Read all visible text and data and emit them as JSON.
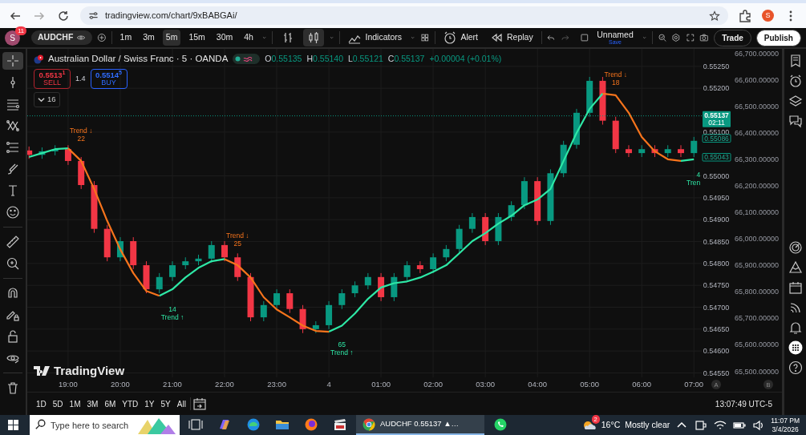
{
  "browser": {
    "url": "tradingview.com/chart/9xBABGAi/",
    "profile_initial": "S"
  },
  "toolbar": {
    "avatar_initial": "S",
    "notification_count": "11",
    "symbol": "AUDCHF",
    "intervals": [
      {
        "label": "1m",
        "selected": false
      },
      {
        "label": "3m",
        "selected": false
      },
      {
        "label": "5m",
        "selected": true
      },
      {
        "label": "15m",
        "selected": false
      },
      {
        "label": "30m",
        "selected": false
      },
      {
        "label": "4h",
        "selected": false
      }
    ],
    "chart_styles": [
      {
        "kind": "bars",
        "selected": false
      },
      {
        "kind": "candles",
        "selected": true
      }
    ],
    "indicators_label": "Indicators",
    "alert_label": "Alert",
    "replay_label": "Replay",
    "layout_name": "Unnamed",
    "layout_status": "Save",
    "trade_label": "Trade",
    "publish_label": "Publish"
  },
  "left_tools": [
    {
      "kind": "crosshair",
      "selected": true
    },
    {
      "kind": "pin",
      "selected": false
    },
    {
      "kind": "lines",
      "selected": false
    },
    {
      "kind": "pattern",
      "selected": false
    },
    {
      "kind": "fib",
      "selected": false
    },
    {
      "kind": "brush",
      "selected": false
    },
    {
      "kind": "text",
      "selected": false
    },
    {
      "kind": "smiley",
      "selected": false
    },
    {
      "kind": "sep"
    },
    {
      "kind": "ruler",
      "selected": false
    },
    {
      "kind": "zoom",
      "selected": false
    },
    {
      "kind": "sep"
    },
    {
      "kind": "magnet",
      "selected": false
    },
    {
      "kind": "pencil-lock",
      "selected": false
    },
    {
      "kind": "lock",
      "selected": false
    },
    {
      "kind": "eye",
      "selected": false
    },
    {
      "kind": "sep"
    },
    {
      "kind": "trash",
      "selected": false
    }
  ],
  "legend": {
    "title": "Australian Dollar / Swiss Franc · 5 · OANDA",
    "ohlc": [
      {
        "label": "O",
        "value": "0.55135"
      },
      {
        "label": "H",
        "value": "0.55140"
      },
      {
        "label": "L",
        "value": "0.55121"
      },
      {
        "label": "C",
        "value": "0.55137"
      }
    ],
    "change": "+0.00004 (+0.01%)",
    "sell": {
      "price": "0.5513$^{1}$",
      "label": "SELL"
    },
    "spread": "1.4",
    "buy": {
      "price": "0.5514$^{5}$",
      "label": "BUY"
    },
    "indicator_count": "16"
  },
  "chart": {
    "chart_data": {
      "type": "candlestick",
      "grid": true,
      "ylim": [
        0.5454,
        0.5529
      ],
      "xlim": [
        "2026-03-03T18:13",
        "2026-03-04T07:09"
      ],
      "x": [
        "2026-03-03T18:15",
        "2026-03-03T18:30",
        "2026-03-03T18:45",
        "2026-03-03T19:00",
        "2026-03-03T19:15",
        "2026-03-03T19:30",
        "2026-03-03T19:45",
        "2026-03-03T20:00",
        "2026-03-03T20:15",
        "2026-03-03T20:30",
        "2026-03-03T20:45",
        "2026-03-03T21:00",
        "2026-03-03T21:15",
        "2026-03-03T21:30",
        "2026-03-03T21:45",
        "2026-03-03T22:00",
        "2026-03-03T22:15",
        "2026-03-03T22:30",
        "2026-03-03T22:45",
        "2026-03-03T23:00",
        "2026-03-03T23:15",
        "2026-03-03T23:30",
        "2026-03-03T23:45",
        "2026-03-04T00:00",
        "2026-03-04T00:15",
        "2026-03-04T00:30",
        "2026-03-04T00:45",
        "2026-03-04T01:00",
        "2026-03-04T01:15",
        "2026-03-04T01:30",
        "2026-03-04T01:45",
        "2026-03-04T02:00",
        "2026-03-04T02:15",
        "2026-03-04T02:30",
        "2026-03-04T02:45",
        "2026-03-04T03:00",
        "2026-03-04T03:15",
        "2026-03-04T03:30",
        "2026-03-04T03:45",
        "2026-03-04T04:00",
        "2026-03-04T04:15",
        "2026-03-04T04:30",
        "2026-03-04T04:45",
        "2026-03-04T05:00",
        "2026-03-04T05:15",
        "2026-03-04T05:30",
        "2026-03-04T05:45",
        "2026-03-04T06:00",
        "2026-03-04T06:15",
        "2026-03-04T06:30",
        "2026-03-04T06:45",
        "2026-03-04T07:00"
      ],
      "xticks": [
        {
          "value": "2026-03-03T19:00",
          "label": "19:00"
        },
        {
          "value": "2026-03-03T20:00",
          "label": "20:00"
        },
        {
          "value": "2026-03-03T21:00",
          "label": "21:00"
        },
        {
          "value": "2026-03-03T22:00",
          "label": "22:00"
        },
        {
          "value": "2026-03-03T23:00",
          "label": "23:00"
        },
        {
          "value": "2026-03-04T00:00",
          "label": "4"
        },
        {
          "value": "2026-03-04T01:00",
          "label": "01:00"
        },
        {
          "value": "2026-03-04T02:00",
          "label": "02:00"
        },
        {
          "value": "2026-03-04T03:00",
          "label": "03:00"
        },
        {
          "value": "2026-03-04T04:00",
          "label": "04:00"
        },
        {
          "value": "2026-03-04T05:00",
          "label": "05:00"
        },
        {
          "value": "2026-03-04T06:00",
          "label": "06:00"
        },
        {
          "value": "2026-03-04T07:00",
          "label": "07:00"
        }
      ],
      "yticks": [
        {
          "value": 0.5525,
          "label": "0.55250"
        },
        {
          "value": 0.552,
          "label": "0.55200"
        },
        {
          "value": 0.551,
          "label": "0.55100"
        },
        {
          "value": 0.55,
          "label": "0.55000"
        },
        {
          "value": 0.5495,
          "label": "0.54950"
        },
        {
          "value": 0.549,
          "label": "0.54900"
        },
        {
          "value": 0.5485,
          "label": "0.54850"
        },
        {
          "value": 0.548,
          "label": "0.54800"
        },
        {
          "value": 0.5475,
          "label": "0.54750"
        },
        {
          "value": 0.547,
          "label": "0.54700"
        },
        {
          "value": 0.5465,
          "label": "0.54650"
        },
        {
          "value": 0.546,
          "label": "0.54600"
        },
        {
          "value": 0.5455,
          "label": "0.54550"
        }
      ],
      "ohlc": [
        [
          0.55058,
          0.55067,
          0.55039,
          0.55048
        ],
        [
          0.55048,
          0.55065,
          0.55039,
          0.55056
        ],
        [
          0.55056,
          0.5507,
          0.55047,
          0.55061
        ],
        [
          0.55061,
          0.5507,
          0.55025,
          0.55034
        ],
        [
          0.55034,
          0.55043,
          0.5497,
          0.54979
        ],
        [
          0.54979,
          0.54988,
          0.5487,
          0.54879
        ],
        [
          0.54879,
          0.54888,
          0.54805,
          0.54814
        ],
        [
          0.54814,
          0.5486,
          0.54805,
          0.54851
        ],
        [
          0.54851,
          0.5486,
          0.54787,
          0.54796
        ],
        [
          0.54796,
          0.54805,
          0.54732,
          0.54741
        ],
        [
          0.54741,
          0.54778,
          0.54732,
          0.54769
        ],
        [
          0.54769,
          0.54805,
          0.5476,
          0.54796
        ],
        [
          0.54796,
          0.54814,
          0.54787,
          0.54805
        ],
        [
          0.54805,
          0.5482,
          0.54796,
          0.54811
        ],
        [
          0.54811,
          0.54851,
          0.54802,
          0.54842
        ],
        [
          0.54842,
          0.54851,
          0.54805,
          0.54814
        ],
        [
          0.54814,
          0.54823,
          0.5476,
          0.54769
        ],
        [
          0.54769,
          0.54778,
          0.54668,
          0.54677
        ],
        [
          0.54677,
          0.54714,
          0.54668,
          0.54705
        ],
        [
          0.54705,
          0.54741,
          0.54696,
          0.54732
        ],
        [
          0.54732,
          0.54741,
          0.54687,
          0.54696
        ],
        [
          0.54696,
          0.54705,
          0.54641,
          0.5465
        ],
        [
          0.5465,
          0.54668,
          0.54641,
          0.54659
        ],
        [
          0.54659,
          0.54714,
          0.5465,
          0.54705
        ],
        [
          0.54705,
          0.54741,
          0.54696,
          0.54732
        ],
        [
          0.54732,
          0.54759,
          0.54723,
          0.5475
        ],
        [
          0.5475,
          0.54778,
          0.54741,
          0.54769
        ],
        [
          0.54769,
          0.54778,
          0.54714,
          0.54723
        ],
        [
          0.54723,
          0.54778,
          0.54714,
          0.54769
        ],
        [
          0.54769,
          0.54805,
          0.5476,
          0.54796
        ],
        [
          0.54796,
          0.54805,
          0.54778,
          0.54787
        ],
        [
          0.54787,
          0.54823,
          0.54778,
          0.54814
        ],
        [
          0.54814,
          0.54842,
          0.54805,
          0.54833
        ],
        [
          0.54833,
          0.54888,
          0.54824,
          0.54879
        ],
        [
          0.54879,
          0.54915,
          0.5487,
          0.54906
        ],
        [
          0.54906,
          0.54915,
          0.54842,
          0.54851
        ],
        [
          0.54851,
          0.54915,
          0.54842,
          0.54906
        ],
        [
          0.54906,
          0.54942,
          0.54897,
          0.54933
        ],
        [
          0.54933,
          0.54997,
          0.54924,
          0.54988
        ],
        [
          0.54988,
          0.54997,
          0.54888,
          0.54897
        ],
        [
          0.54897,
          0.55015,
          0.54888,
          0.55006
        ],
        [
          0.55006,
          0.5508,
          0.54997,
          0.55071
        ],
        [
          0.55071,
          0.55153,
          0.55062,
          0.55144
        ],
        [
          0.55144,
          0.55226,
          0.55135,
          0.55217
        ],
        [
          0.55217,
          0.55226,
          0.55117,
          0.55126
        ],
        [
          0.55126,
          0.55135,
          0.55052,
          0.55061
        ],
        [
          0.55061,
          0.5507,
          0.55043,
          0.55052
        ],
        [
          0.55052,
          0.5507,
          0.55043,
          0.55061
        ],
        [
          0.55061,
          0.5507,
          0.55043,
          0.55052
        ],
        [
          0.55052,
          0.5507,
          0.55043,
          0.55061
        ],
        [
          0.55061,
          0.5507,
          0.55043,
          0.55052
        ],
        [
          0.55052,
          0.55089,
          0.55043,
          0.5508
        ]
      ],
      "series": [
        {
          "type": "line",
          "color": "#2ee8a6",
          "values": [
            0.55043,
            0.55052,
            0.55061,
            0.55063,
            null,
            null,
            null,
            null,
            null,
            null,
            0.54726,
            0.54741,
            0.54768,
            0.5479,
            0.54805,
            0.5481,
            null,
            null,
            null,
            null,
            null,
            null,
            null,
            0.54644,
            0.54658,
            0.54686,
            0.54719,
            0.54745,
            0.54755,
            0.54759,
            0.54768,
            0.54781,
            0.54796,
            0.54823,
            0.54851,
            0.54869,
            0.54891,
            0.54909,
            0.54933,
            0.54946,
            0.5497,
            0.55034,
            0.55098,
            0.55153,
            0.55188,
            null,
            null,
            null,
            null,
            null,
            0.55034,
            0.55038
          ]
        },
        {
          "type": "line",
          "color": "#f7741c",
          "values": [
            null,
            null,
            null,
            0.55063,
            0.55034,
            0.5497,
            0.54897,
            0.54832,
            0.54778,
            0.54737,
            0.54726,
            null,
            null,
            null,
            null,
            0.5481,
            0.54796,
            0.54768,
            0.54723,
            0.54695,
            0.54677,
            0.54658,
            0.54646,
            0.54644,
            null,
            null,
            null,
            null,
            null,
            null,
            null,
            null,
            null,
            null,
            null,
            null,
            null,
            null,
            null,
            null,
            null,
            null,
            null,
            null,
            0.55188,
            0.55184,
            0.55144,
            0.55089,
            0.55056,
            0.55038,
            0.55034,
            null
          ]
        }
      ],
      "ref_lines": [
        {
          "axis": "y",
          "value": 0.55137,
          "label": "0.55137"
        }
      ],
      "annotations": [
        "Trend ↓\n22",
        "14\nTrend ↑",
        "Trend ↓\n25",
        "65\nTrend ↑",
        "Trend ↓\n18",
        "4\nTren",
        "0.55086",
        "0.55043"
      ]
    },
    "countdown": "02:11",
    "secondary_scale": [
      "66,700.00000",
      "66,600.00000",
      "66,500.00000",
      "66,400.00000",
      "66,300.00000",
      "66,200.00000",
      "66,100.00000",
      "66,000.00000",
      "65,900.00000",
      "65,800.00000",
      "65,700.00000",
      "65,600.00000",
      "65,500.00000"
    ],
    "scale_buttons": [
      "A",
      "B"
    ],
    "logo_text": "TradingView"
  },
  "right_tools": [
    {
      "kind": "watchlist"
    },
    {
      "kind": "alarm"
    },
    {
      "kind": "layers"
    },
    {
      "kind": "chat"
    },
    {
      "kind": "gap"
    },
    {
      "kind": "target"
    },
    {
      "kind": "pyramid"
    },
    {
      "kind": "calendar"
    },
    {
      "kind": "signal"
    },
    {
      "kind": "bell"
    },
    {
      "kind": "apps"
    },
    {
      "kind": "help"
    }
  ],
  "range_bar": {
    "ranges": [
      "1D",
      "5D",
      "1M",
      "3M",
      "6M",
      "YTD",
      "1Y",
      "5Y",
      "All"
    ],
    "clock": "13:07:49 UTC-5"
  },
  "taskbar": {
    "search_placeholder": "Type here to search",
    "apps": [
      {
        "kind": "task-view",
        "selected": false
      },
      {
        "kind": "copilot",
        "selected": false
      },
      {
        "kind": "edge",
        "selected": false
      },
      {
        "kind": "folder",
        "selected": false
      },
      {
        "kind": "firefox",
        "selected": false
      },
      {
        "kind": "clapper",
        "selected": false
      },
      {
        "kind": "chrome",
        "label": "AUDCHF 0.55137 ▲…",
        "selected": true
      },
      {
        "kind": "whatsapp",
        "selected": false
      }
    ],
    "weather_badge": "2",
    "temperature": "16°C",
    "weather": "Mostly clear",
    "time": "11:07 PM",
    "date": "3/4/2026"
  }
}
